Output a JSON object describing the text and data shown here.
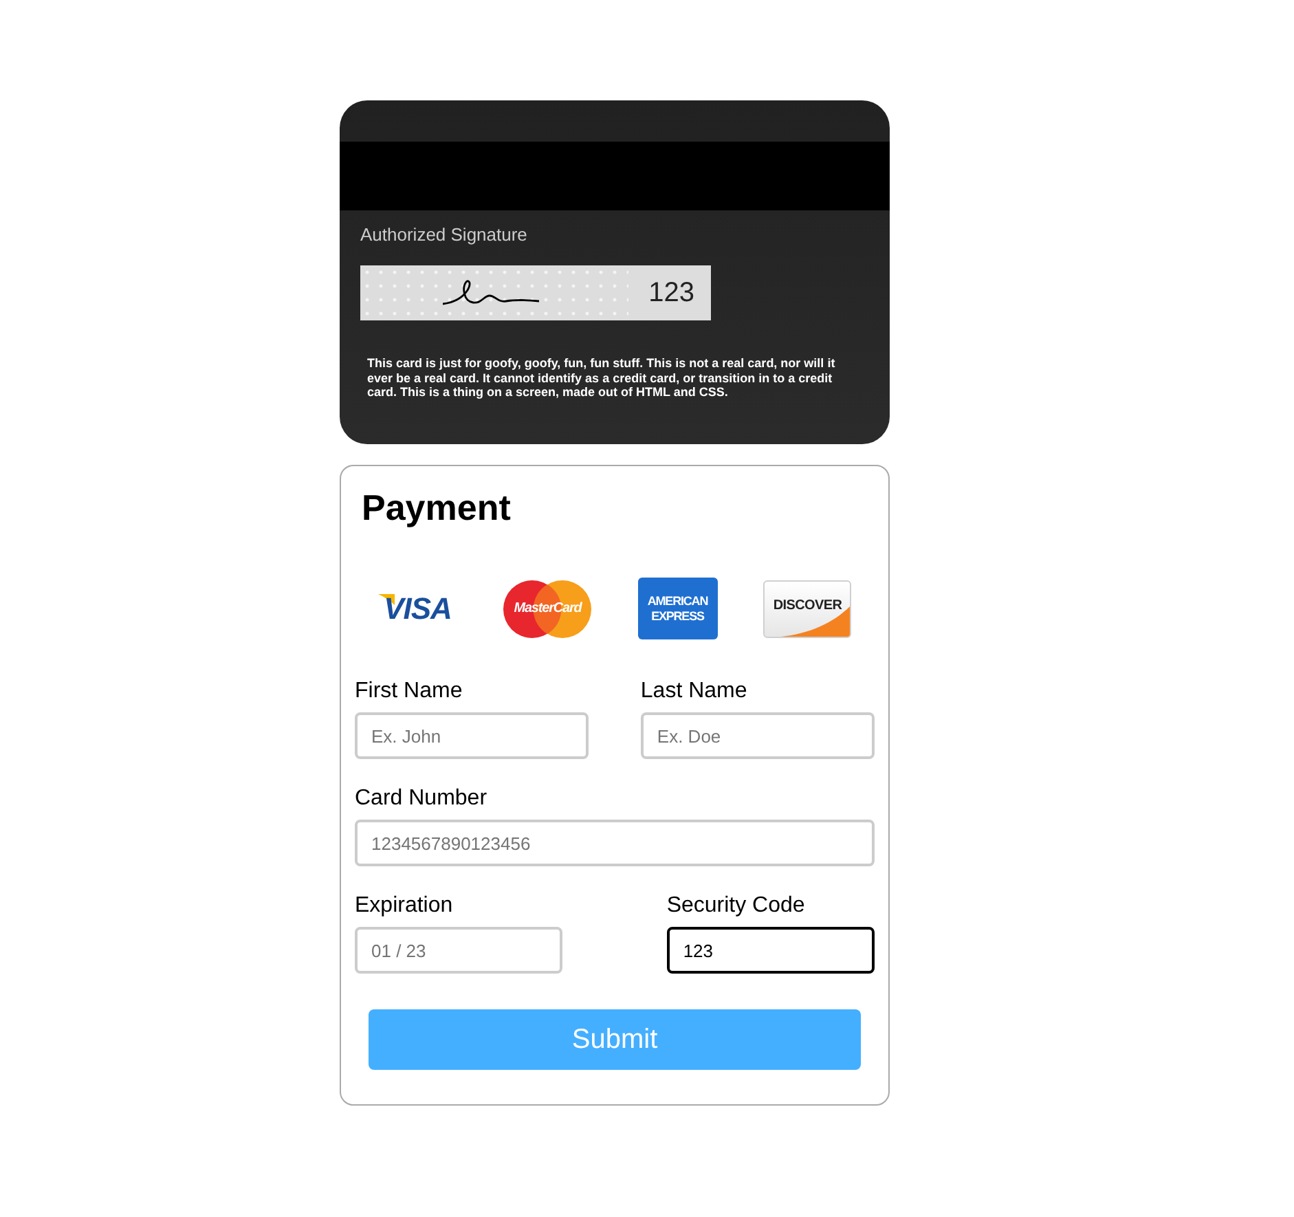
{
  "card_back": {
    "signature_label": "Authorized Signature",
    "cvv": "123",
    "disclaimer": "This card is just for goofy, goofy, fun, fun stuff. This is not a real card, nor will it ever be a real card. It cannot identify as a credit card, or transition in to a credit card. This is a thing on a screen, made out of HTML and CSS."
  },
  "payment": {
    "title": "Payment",
    "card_logos": [
      {
        "kind": "visa",
        "label": "VISA"
      },
      {
        "kind": "mastercard",
        "label": "MasterCard"
      },
      {
        "kind": "amex",
        "label": "AMERICAN EXPRESS"
      },
      {
        "kind": "discover",
        "label": "DISCOVER"
      }
    ],
    "first_name": {
      "label": "First Name",
      "placeholder": "Ex. John",
      "focused": false
    },
    "last_name": {
      "label": "Last Name",
      "placeholder": "Ex. Doe",
      "focused": false
    },
    "card_number": {
      "label": "Card Number",
      "placeholder": "1234567890123456",
      "focused": false
    },
    "expiration": {
      "label": "Expiration",
      "placeholder": "01 / 23",
      "focused": false
    },
    "security_code": {
      "label": "Security Code",
      "value": "123",
      "focused": true
    },
    "submit": "Submit"
  }
}
